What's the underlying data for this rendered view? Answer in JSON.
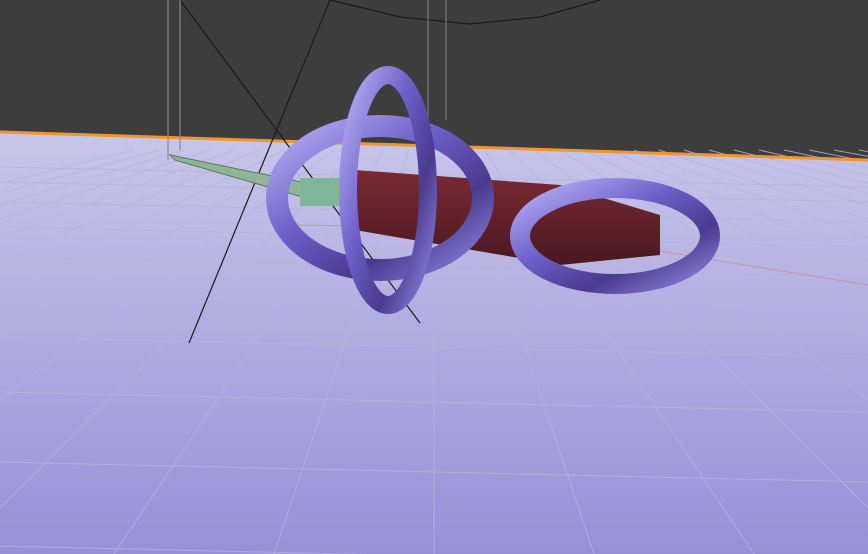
{
  "viewport": {
    "colors": {
      "background": "#3d3d3d",
      "horizon": "#f0962e",
      "floor_top": "#c4c2e6",
      "floor_bottom": "#9a94d8",
      "ring": "#6d63c9",
      "box": "#6a1f28",
      "blade": "#8fb596"
    }
  }
}
